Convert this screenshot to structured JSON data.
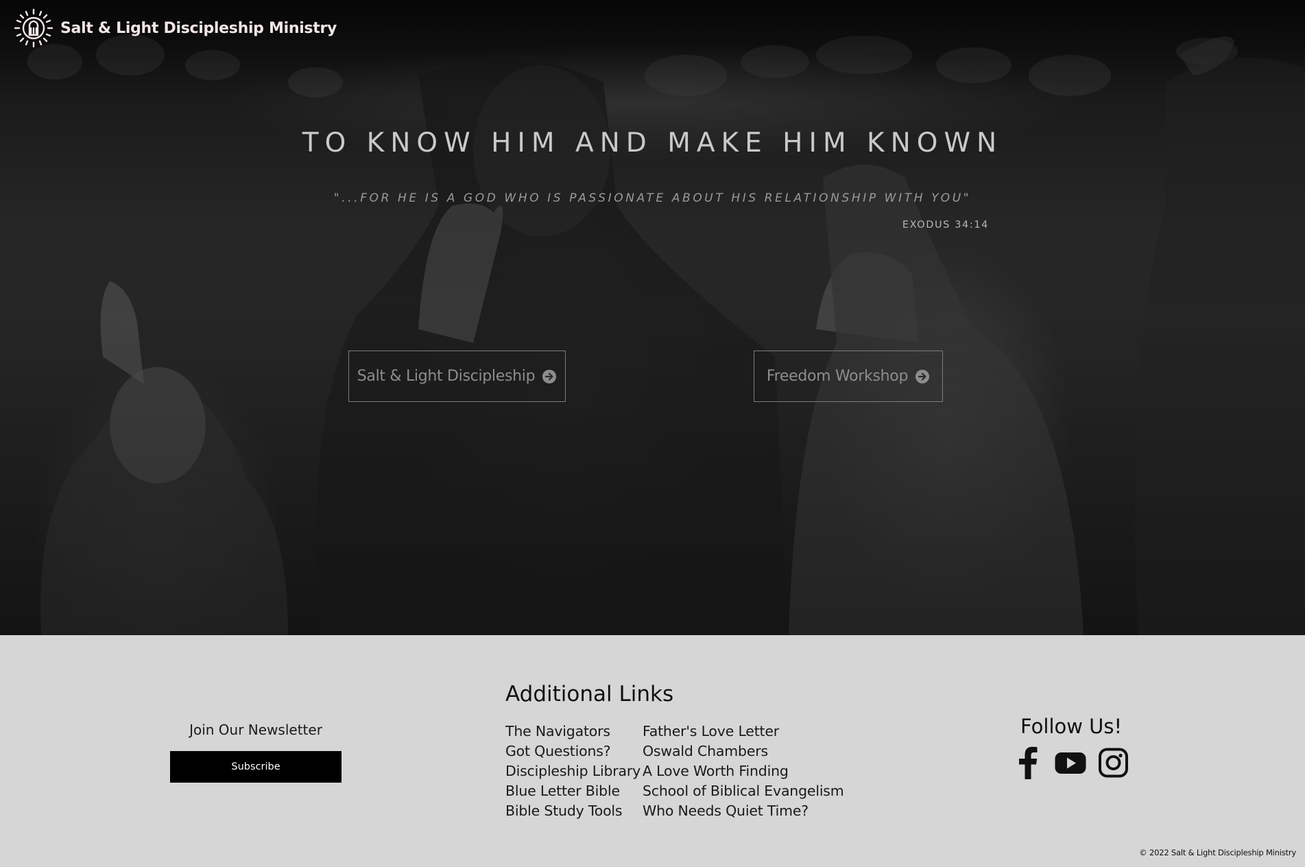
{
  "header": {
    "brand_name": "Salt & Light Discipleship Ministry",
    "logo_icon": "sun-salt-shaker-logo-icon"
  },
  "hero": {
    "title": "TO KNOW HIM AND MAKE HIM KNOWN",
    "quote": "\"...FOR HE IS A GOD WHO IS PASSIONATE ABOUT HIS RELATIONSHIP WITH YOU\"",
    "reference": "EXODUS 34:14",
    "buttons": [
      {
        "label": "Salt & Light Discipleship",
        "icon": "arrow-circle-right-icon"
      },
      {
        "label": "Freedom Workshop",
        "icon": "arrow-circle-right-icon"
      }
    ]
  },
  "newsletter": {
    "title": "Join Our Newsletter",
    "button_label": "Subscribe"
  },
  "additional_links": {
    "title": "Additional Links",
    "column_1": [
      "The Navigators",
      "Got Questions?",
      "Discipleship Library",
      "Blue Letter Bible",
      "Bible Study Tools"
    ],
    "column_2": [
      "Father's Love Letter",
      "Oswald Chambers",
      "A Love Worth Finding",
      "School of Biblical Evangelism",
      "Who Needs Quiet Time?"
    ]
  },
  "social": {
    "title": "Follow Us!",
    "icons": [
      "facebook-icon",
      "youtube-icon",
      "instagram-icon"
    ]
  },
  "footer": {
    "copyright": "© 2022 Salt & Light Discipleship Ministry"
  },
  "colors": {
    "footer_background": "#d6d6d6",
    "subscribe_button": "#000000",
    "brand_text": "#f4e6e6"
  }
}
